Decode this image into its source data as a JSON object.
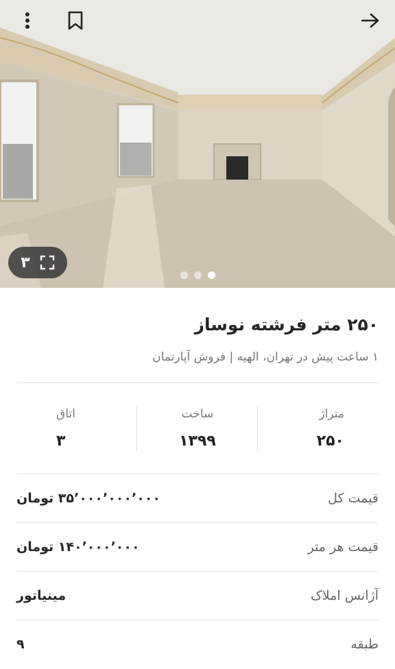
{
  "header": {
    "more_icon": "more-vertical-icon",
    "bookmark_icon": "bookmark-icon",
    "back_icon": "arrow-right-icon"
  },
  "gallery": {
    "count": "۳",
    "expand_icon": "expand-icon",
    "slides_total": 3,
    "active_slide": 1
  },
  "listing": {
    "title": "۲۵۰ متر فرشته نوساز",
    "subtitle": "۱ ساعت پیش در تهران، الهیه | فروش آپارتمان"
  },
  "stats": [
    {
      "label": "متراژ",
      "value": "۲۵۰"
    },
    {
      "label": "ساخت",
      "value": "۱۳۹۹"
    },
    {
      "label": "اتاق",
      "value": "۳"
    }
  ],
  "details": [
    {
      "key": "قیمت کل",
      "value": "۳۵٬۰۰۰٬۰۰۰٬۰۰۰ تومان"
    },
    {
      "key": "قیمت هر متر",
      "value": "۱۴۰٬۰۰۰٬۰۰۰ تومان"
    },
    {
      "key": "آژانس املاک",
      "value": "مینیاتور"
    },
    {
      "key": "طبقه",
      "value": "۹"
    }
  ],
  "colors": {
    "wall": "#d9d2c3",
    "floor": "#c9bfae",
    "ceiling": "#e8e6e1",
    "gold_trim": "#c4a870"
  }
}
